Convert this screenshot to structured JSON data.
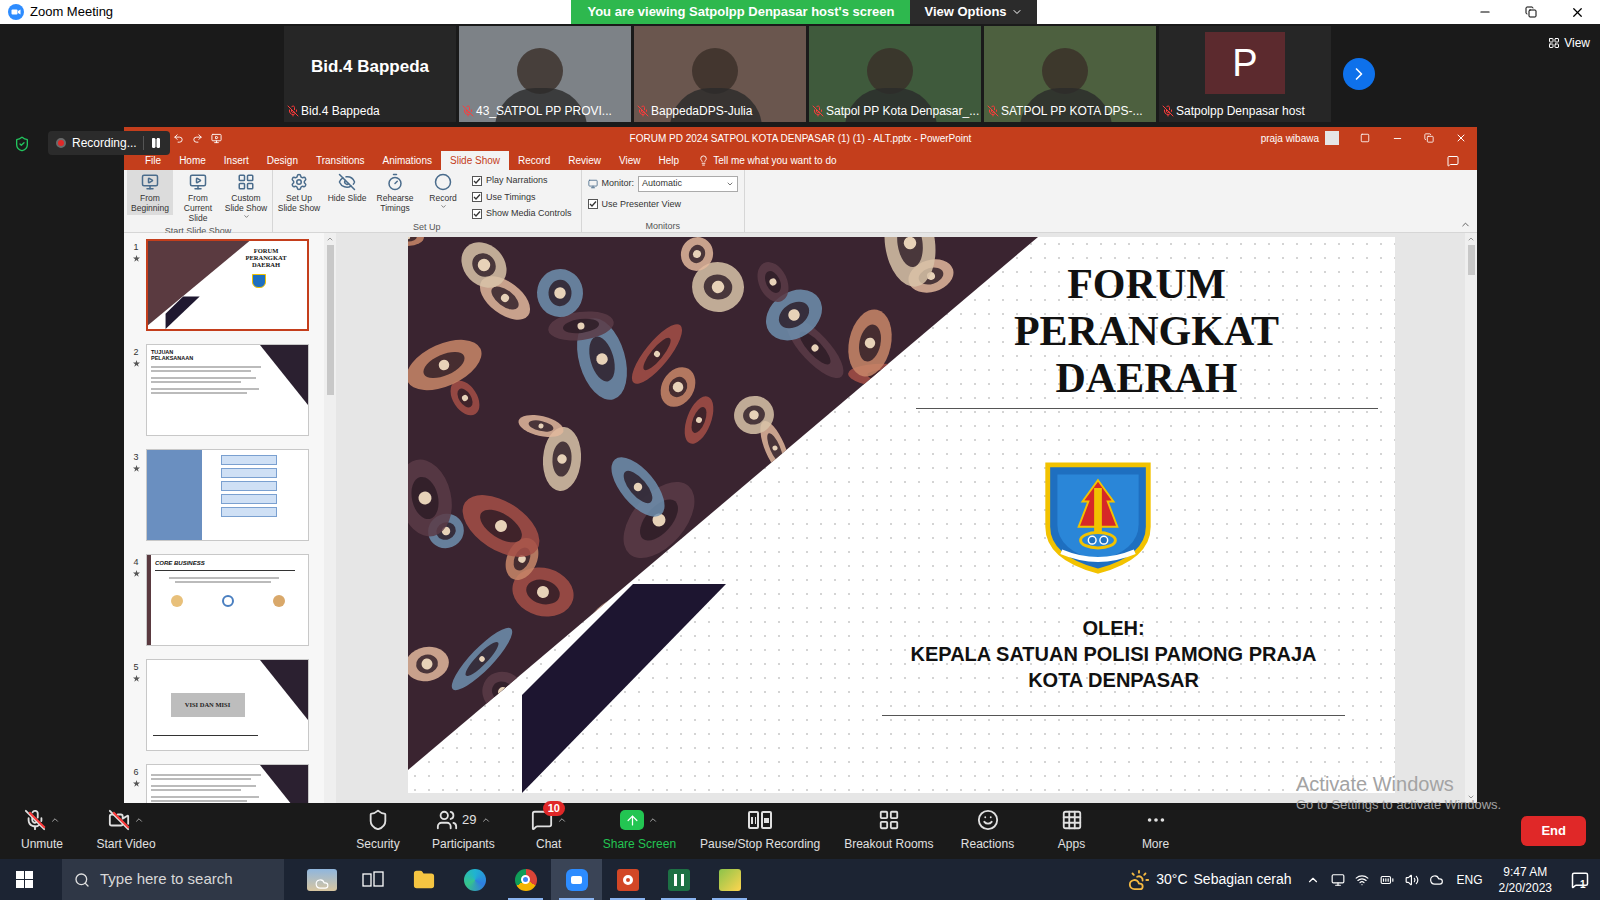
{
  "zoom_window": {
    "title": "Zoom Meeting",
    "banner": "You are viewing Satpolpp Denpasar host's screen",
    "view_options": "View Options"
  },
  "gallery": {
    "view_button": "View",
    "tiles": [
      {
        "kind": "name",
        "name": "Bid.4 Bappeda",
        "label": "Bid.4 Bappeda",
        "muted": true
      },
      {
        "kind": "video",
        "name": "",
        "label": "43_SATPOL PP PROVI...",
        "muted": true
      },
      {
        "kind": "video",
        "name": "",
        "label": "BappedaDPS-Julia",
        "muted": true
      },
      {
        "kind": "video",
        "name": "",
        "label": "Satpol PP Kota Denpasar_...",
        "muted": true
      },
      {
        "kind": "video",
        "name": "",
        "label": "SATPOL PP KOTA DPS-...",
        "muted": true
      },
      {
        "kind": "avatar",
        "name": "P",
        "label": "Satpolpp Denpasar host",
        "muted": true
      }
    ]
  },
  "recording": {
    "label": "Recording...",
    "paused": false
  },
  "powerpoint": {
    "title": "FORUM PD 2024 SATPOL KOTA DENPASAR (1) (1) - ALT.pptx - PowerPoint",
    "user": "praja wibawa",
    "tabs": [
      {
        "label": "File",
        "selected": false
      },
      {
        "label": "Home",
        "selected": false
      },
      {
        "label": "Insert",
        "selected": false
      },
      {
        "label": "Design",
        "selected": false
      },
      {
        "label": "Transitions",
        "selected": false
      },
      {
        "label": "Animations",
        "selected": false
      },
      {
        "label": "Slide Show",
        "selected": true
      },
      {
        "label": "Record",
        "selected": false
      },
      {
        "label": "Review",
        "selected": false
      },
      {
        "label": "View",
        "selected": false
      },
      {
        "label": "Help",
        "selected": false
      }
    ],
    "tell_me": "Tell me what you want to do",
    "ribbon": {
      "groups": [
        {
          "label": "Start Slide Show",
          "buttons": [
            {
              "label": "From Beginning",
              "dropdown": false,
              "hovered": true
            },
            {
              "label": "From Current Slide",
              "dropdown": false,
              "hovered": false
            },
            {
              "label": "Custom Slide Show",
              "dropdown": true,
              "hovered": false
            }
          ],
          "checkboxes": []
        },
        {
          "label": "Set Up",
          "buttons": [
            {
              "label": "Set Up Slide Show",
              "dropdown": false,
              "hovered": false
            },
            {
              "label": "Hide Slide",
              "dropdown": false,
              "hovered": false
            },
            {
              "label": "Rehearse Timings",
              "dropdown": false,
              "hovered": false
            },
            {
              "label": "Record",
              "dropdown": true,
              "hovered": false
            }
          ],
          "checkboxes": [
            {
              "label": "Play Narrations",
              "checked": true
            },
            {
              "label": "Use Timings",
              "checked": true
            },
            {
              "label": "Show Media Controls",
              "checked": true
            }
          ]
        }
      ],
      "monitors": {
        "label": "Monitors",
        "monitor_label": "Monitor:",
        "monitor_value": "Automatic",
        "presenter_view": {
          "label": "Use Presenter View",
          "checked": true
        }
      }
    },
    "thumbnails": [
      {
        "number": "1",
        "selected": true,
        "kind": "title",
        "title": "FORUM PERANGKAT DAERAH"
      },
      {
        "number": "2",
        "selected": false,
        "kind": "text",
        "title": "TUJUAN PELAKSANAAN"
      },
      {
        "number": "3",
        "selected": false,
        "kind": "diagram",
        "title": ""
      },
      {
        "number": "4",
        "selected": false,
        "kind": "core",
        "title": "CORE BUSINESS"
      },
      {
        "number": "5",
        "selected": false,
        "kind": "section",
        "title": "VISI DAN MISI"
      },
      {
        "number": "6",
        "selected": false,
        "kind": "text",
        "title": ""
      }
    ],
    "slide": {
      "title_lines": [
        "FORUM",
        "PERANGKAT",
        "DAERAH"
      ],
      "by": "OLEH:",
      "presenter_lines": [
        "KEPALA SATUAN POLISI PAMONG PRAJA",
        "KOTA DENPASAR"
      ]
    }
  },
  "toolbar": {
    "items": [
      {
        "label": "Unmute",
        "count": "",
        "badge": "",
        "caret": true,
        "highlighted": false,
        "off": true
      },
      {
        "label": "Start Video",
        "count": "",
        "badge": "",
        "caret": true,
        "highlighted": false,
        "off": true
      },
      {
        "label": "Security",
        "count": "",
        "badge": "",
        "caret": false,
        "highlighted": false,
        "off": false
      },
      {
        "label": "Participants",
        "count": "29",
        "badge": "",
        "caret": true,
        "highlighted": false,
        "off": false
      },
      {
        "label": "Chat",
        "count": "",
        "badge": "10",
        "caret": true,
        "highlighted": false,
        "off": false
      },
      {
        "label": "Share Screen",
        "count": "",
        "badge": "",
        "caret": true,
        "highlighted": true,
        "off": false
      },
      {
        "label": "Pause/Stop Recording",
        "count": "",
        "badge": "",
        "caret": false,
        "highlighted": false,
        "off": false
      },
      {
        "label": "Breakout Rooms",
        "count": "",
        "badge": "",
        "caret": false,
        "highlighted": false,
        "off": false
      },
      {
        "label": "Reactions",
        "count": "",
        "badge": "",
        "caret": false,
        "highlighted": false,
        "off": false
      },
      {
        "label": "Apps",
        "count": "",
        "badge": "",
        "caret": false,
        "highlighted": false,
        "off": false
      },
      {
        "label": "More",
        "count": "",
        "badge": "",
        "caret": false,
        "highlighted": false,
        "off": false
      }
    ],
    "end": "End"
  },
  "watermark": {
    "title": "Activate Windows",
    "subtitle": "Go to Settings to activate Windows."
  },
  "taskbar": {
    "search": "Type here to search",
    "apps": [
      {
        "running": false,
        "selected": false
      },
      {
        "running": false,
        "selected": false
      },
      {
        "running": false,
        "selected": false
      },
      {
        "running": false,
        "selected": false
      },
      {
        "running": true,
        "selected": false
      },
      {
        "running": true,
        "selected": true
      },
      {
        "running": true,
        "selected": false
      },
      {
        "running": true,
        "selected": false
      },
      {
        "running": true,
        "selected": false
      }
    ],
    "weather": {
      "temperature": "30°C",
      "condition": "Sebagian cerah"
    },
    "language": "ENG",
    "time": "9:47 AM",
    "date": "2/20/2023",
    "notifications": "1"
  }
}
